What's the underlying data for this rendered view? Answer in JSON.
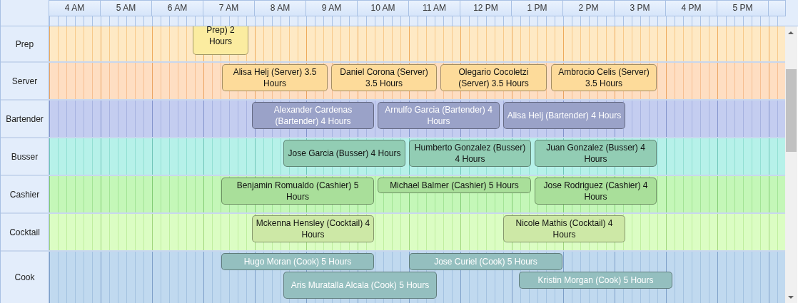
{
  "timeline": {
    "hours": [
      "4 AM",
      "5 AM",
      "6 AM",
      "7 AM",
      "8 AM",
      "9 AM",
      "10 AM",
      "11 AM",
      "12 PM",
      "1 PM",
      "2 PM",
      "3 PM",
      "4 PM",
      "5 PM"
    ]
  },
  "rows": [
    {
      "label": "Prep",
      "color": "#fbeca0",
      "events": [
        {
          "text": "Prep) 2 Hours"
        }
      ]
    },
    {
      "label": "Server",
      "color": "#fddb9a",
      "events": [
        {
          "text": "Alisa Helj (Server) 3.5 Hours"
        },
        {
          "text": "Daniel Corona (Server) 3.5 Hours"
        },
        {
          "text": "Olegario Cocoletzi (Server) 3.5 Hours"
        },
        {
          "text": "Ambrocio Celis (Server) 3.5 Hours"
        }
      ]
    },
    {
      "label": "Bartender",
      "color": "#9aa2c8",
      "events": [
        {
          "text": "Alexander Cardenas (Bartender) 4 Hours"
        },
        {
          "text": "Arnulfo Garcia (Bartender) 4 Hours"
        },
        {
          "text": "Alisa Helj (Bartender) 4 Hours"
        }
      ]
    },
    {
      "label": "Busser",
      "color": "#92cdb4",
      "events": [
        {
          "text": "Jose Garcia (Busser) 4 Hours"
        },
        {
          "text": "Humberto Gonzalez (Busser) 4 Hours"
        },
        {
          "text": "Juan Gonzalez (Busser) 4 Hours"
        }
      ]
    },
    {
      "label": "Cashier",
      "color": "#a9df9a",
      "events": [
        {
          "text": "Benjamin Romualdo (Cashier) 5 Hours"
        },
        {
          "text": "Michael Balmer (Cashier) 5 Hours"
        },
        {
          "text": "Jose Rodriguez (Cashier) 4 Hours"
        }
      ]
    },
    {
      "label": "Cocktail",
      "color": "#cde8a6",
      "events": [
        {
          "text": "Mckenna Hensley (Cocktail) 4 Hours"
        },
        {
          "text": "Nicole Mathis (Cocktail) 4 Hours"
        }
      ]
    },
    {
      "label": "Cook",
      "color": "#94bfbf",
      "events": [
        {
          "text": "Hugo Moran (Cook) 5 Hours"
        },
        {
          "text": "Jose Curiel (Cook) 5 Hours"
        },
        {
          "text": "Aris Muratalla Alcala (Cook) 5 Hours"
        },
        {
          "text": "Kristin Morgan (Cook) 5 Hours"
        }
      ]
    }
  ]
}
